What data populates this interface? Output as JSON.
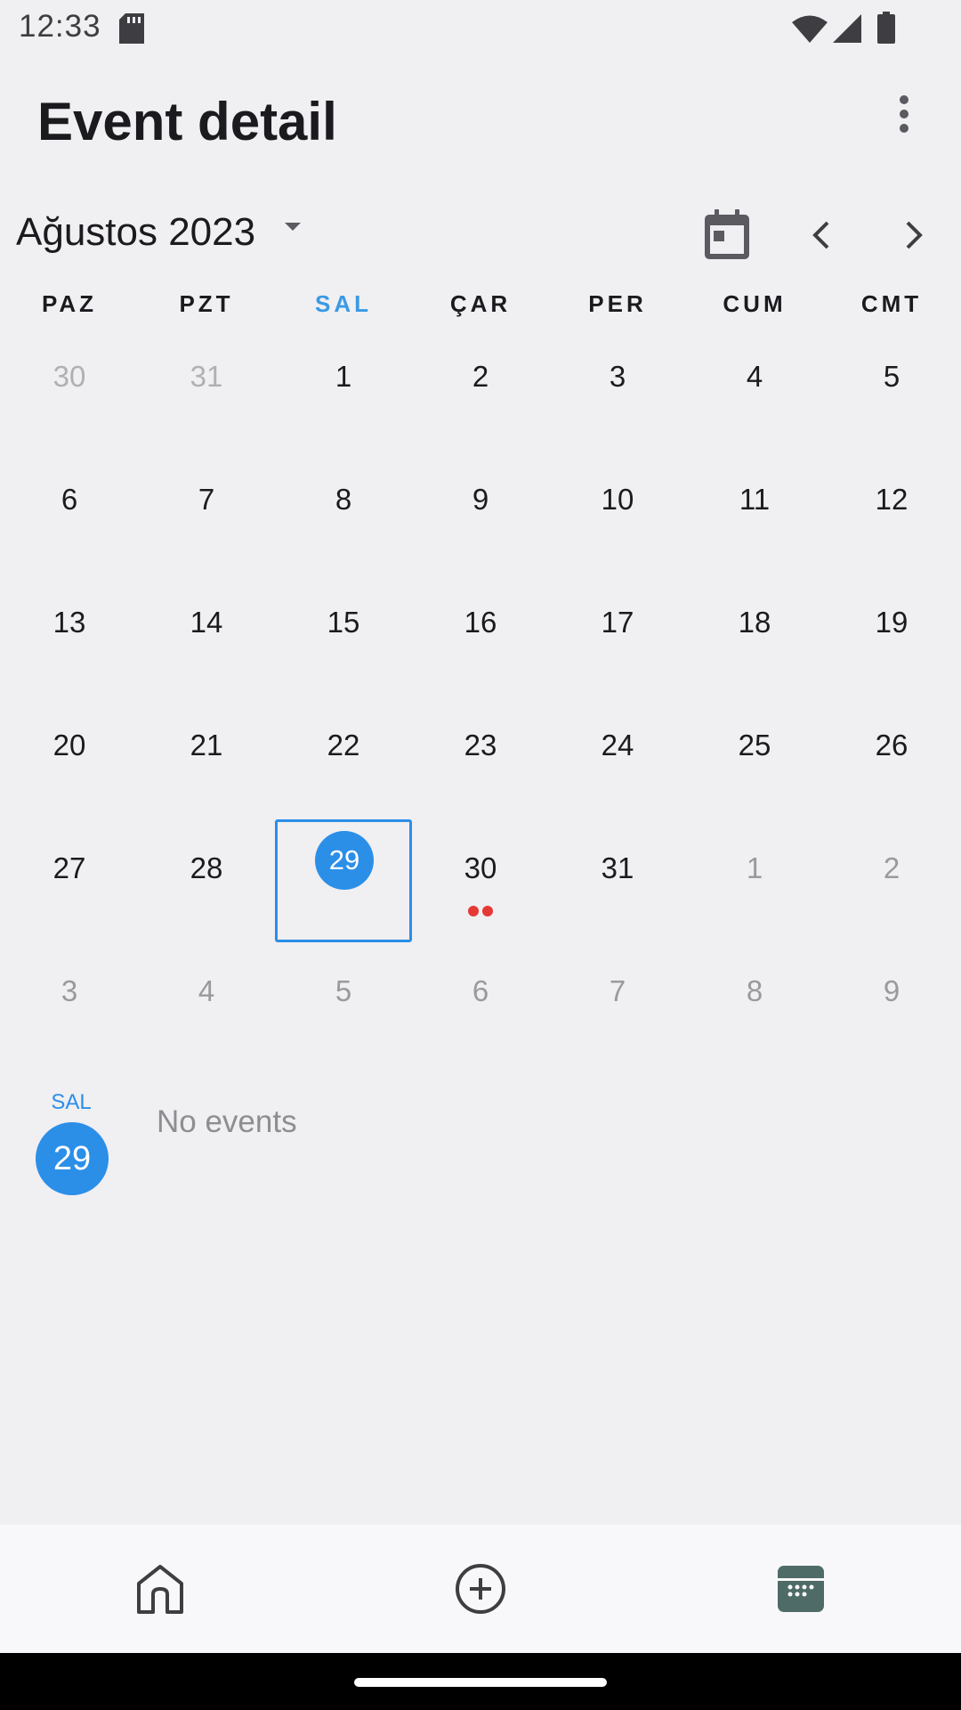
{
  "status_bar": {
    "time": "12:33",
    "icons": [
      "sd-card-icon",
      "wifi-icon",
      "signal-icon",
      "battery-icon"
    ]
  },
  "header": {
    "title": "Event detail",
    "menu_icon": "more-vert-icon"
  },
  "calendar": {
    "month_label": "Ağustos 2023",
    "controls": [
      "dropdown-caret-icon",
      "calendar-today-icon",
      "chevron-left-icon",
      "chevron-right-icon"
    ],
    "weekdays": [
      "PAZ",
      "PZT",
      "SAL",
      "ÇAR",
      "PER",
      "CUM",
      "CMT"
    ],
    "highlighted_weekday": "SAL",
    "weeks": [
      [
        "30",
        "31",
        "1",
        "2",
        "3",
        "4",
        "5"
      ],
      [
        "6",
        "7",
        "8",
        "9",
        "10",
        "11",
        "12"
      ],
      [
        "13",
        "14",
        "15",
        "16",
        "17",
        "18",
        "19"
      ],
      [
        "20",
        "21",
        "22",
        "23",
        "24",
        "25",
        "26"
      ],
      [
        "27",
        "28",
        "29",
        "30",
        "31",
        "1",
        "2"
      ],
      [
        "3",
        "4",
        "5",
        "6",
        "7",
        "8",
        "9"
      ]
    ],
    "selected_day": "29",
    "days_with_events": [
      {
        "day": "30",
        "event_count": 2
      }
    ]
  },
  "agenda": {
    "weekday": "SAL",
    "day": "29",
    "empty_text": "No events"
  },
  "bottom_nav": {
    "items": [
      "home-icon",
      "add-circle-icon",
      "calendar-icon"
    ],
    "active": "calendar-icon"
  },
  "colors": {
    "accent": "#2b8fe8",
    "event_dot": "#e53935",
    "background": "#f0eff2",
    "nav_active": "#4f6b67"
  }
}
